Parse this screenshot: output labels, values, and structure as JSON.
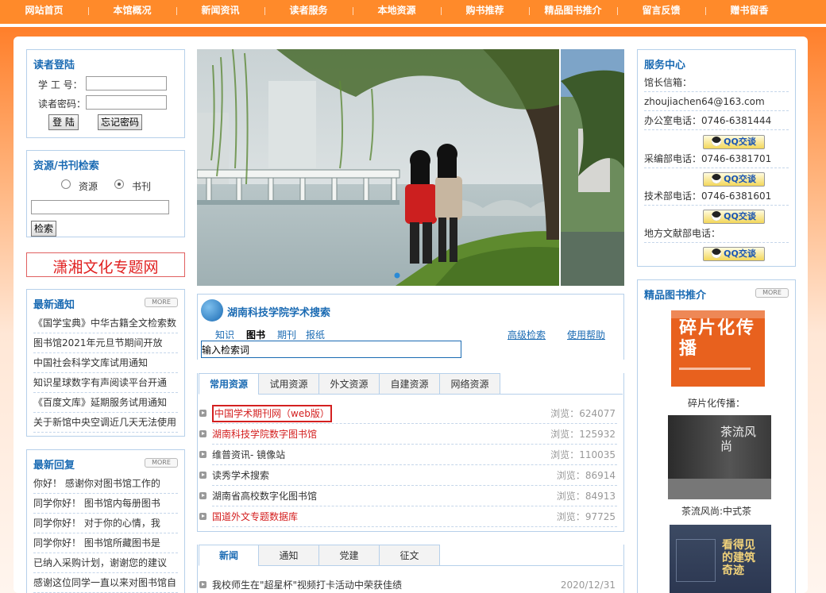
{
  "nav": {
    "items": [
      "网站首页",
      "本馆概况",
      "新闻资讯",
      "读者服务",
      "本地资源",
      "购书推荐",
      "精品图书推介",
      "留言反馈",
      "赠书留香"
    ]
  },
  "login": {
    "title": "读者登陆",
    "id_label": "学 工 号：",
    "pwd_label": "读者密码：",
    "login_btn": "登 陆",
    "forgot_btn": "忘记密码"
  },
  "search": {
    "title": "资源/书刊检索",
    "opt1": "资源",
    "opt2": "书刊",
    "selected": "书刊",
    "btn": "检索"
  },
  "banner": {
    "text": "潇湘文化专题网"
  },
  "notices": {
    "title": "最新通知",
    "more": "MORE",
    "items": [
      "《国学宝典》中华古籍全文检索数",
      "图书馆2021年元旦节期间开放",
      "中国社会科学文库试用通知",
      "知识星球数字有声阅读平台开通",
      "《百度文库》延期服务试用通知",
      "关于新馆中央空调近几天无法使用"
    ]
  },
  "replies": {
    "title": "最新回复",
    "more": "MORE",
    "items": [
      "你好！ 感谢你对图书馆工作的",
      "同学你好！ 图书馆内每册图书",
      "同学你好！ 对于你的心情，我",
      "同学你好！ 图书馆所藏图书是",
      "已纳入采购计划，谢谢您的建议",
      "感谢这位同学一直以来对图书馆自"
    ]
  },
  "scholar": {
    "logo_text": "湖南科技学院学术搜索",
    "tabs": [
      "知识",
      "图书",
      "期刊",
      "报纸"
    ],
    "active_tab": "图书",
    "advanced": "高级检索",
    "help": "使用帮助",
    "input_value": "输入检索词"
  },
  "resources": {
    "tabs": [
      "常用资源",
      "试用资源",
      "外文资源",
      "自建资源",
      "网络资源"
    ],
    "active": "常用资源",
    "view_label": "浏览：",
    "items": [
      {
        "name": "中国学术期刊网（web版）",
        "count": "624077",
        "red": true,
        "boxed": true
      },
      {
        "name": "湖南科技学院数字图书馆",
        "count": "125932",
        "red": true
      },
      {
        "name": "维普资讯- 镜像站",
        "count": "110035",
        "red": false
      },
      {
        "name": "读秀学术搜索",
        "count": "86914",
        "red": false
      },
      {
        "name": "湖南省高校数字化图书馆",
        "count": "84913",
        "red": false
      },
      {
        "name": "国道外文专题数据库",
        "count": "97725",
        "red": true
      }
    ]
  },
  "news": {
    "tabs": [
      "新闻",
      "通知",
      "党建",
      "征文"
    ],
    "active": "新闻",
    "items": [
      {
        "title": "我校师生在\"超星杯\"视频打卡活动中荣获佳绩",
        "date": "2020/12/31"
      }
    ]
  },
  "service": {
    "title": "服务中心",
    "rows": [
      "馆长信箱：",
      "zhoujiachen64@163.com",
      "办公室电话：0746-6381444",
      "采编部电话：0746-6381701",
      "技术部电话：0746-6381601",
      "地方文献部电话："
    ],
    "qq_label": "QQ交谈"
  },
  "books": {
    "title": "精品图书推介",
    "more": "MORE",
    "items": [
      {
        "caption": "碎片化传播：",
        "cover_title": "碎片化传播"
      },
      {
        "caption": "茶流风尚:中式茶",
        "cover_title": "茶流风尚"
      },
      {
        "caption": "",
        "cover_title": "看得见的建筑奇迹"
      }
    ]
  },
  "colors": {
    "accent": "#ff8a2a",
    "link_blue": "#1b6bb3",
    "red": "#d42020"
  }
}
